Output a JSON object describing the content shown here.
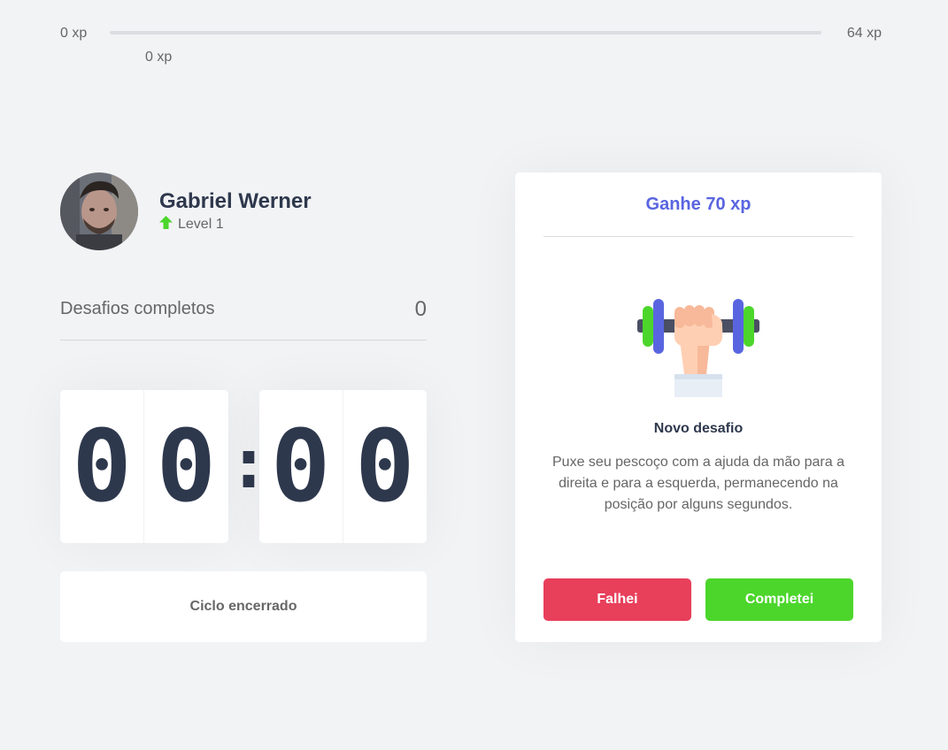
{
  "xp": {
    "min_label": "0 xp",
    "current_label": "0 xp",
    "max_label": "64 xp",
    "progress_percent": 0,
    "fill_color": "#4cd62b"
  },
  "profile": {
    "name": "Gabriel Werner",
    "level_label": "Level 1",
    "level_icon": "level-up-arrow-icon",
    "level_icon_color": "#4cd62b"
  },
  "completed_challenges": {
    "label": "Desafios completos",
    "count": "0"
  },
  "countdown": {
    "minute_left": "0",
    "minute_right": "0",
    "separator": ":",
    "second_left": "0",
    "second_right": "0"
  },
  "cycle_button": {
    "label": "Ciclo encerrado"
  },
  "challenge": {
    "header": "Ganhe 70 xp",
    "icon": "dumbbell-icon",
    "title": "Novo desafio",
    "description": "Puxe seu pescoço com a ajuda da mão para a direita e para a esquerda, permanecendo na posição por alguns segundos.",
    "fail_label": "Falhei",
    "success_label": "Completei"
  },
  "colors": {
    "background": "#f2f3f5",
    "accent_blue": "#5965e0",
    "fail_red": "#e83f5b",
    "success_green": "#4cd62b",
    "title_dark": "#2e384d",
    "text_gray": "#666666"
  }
}
